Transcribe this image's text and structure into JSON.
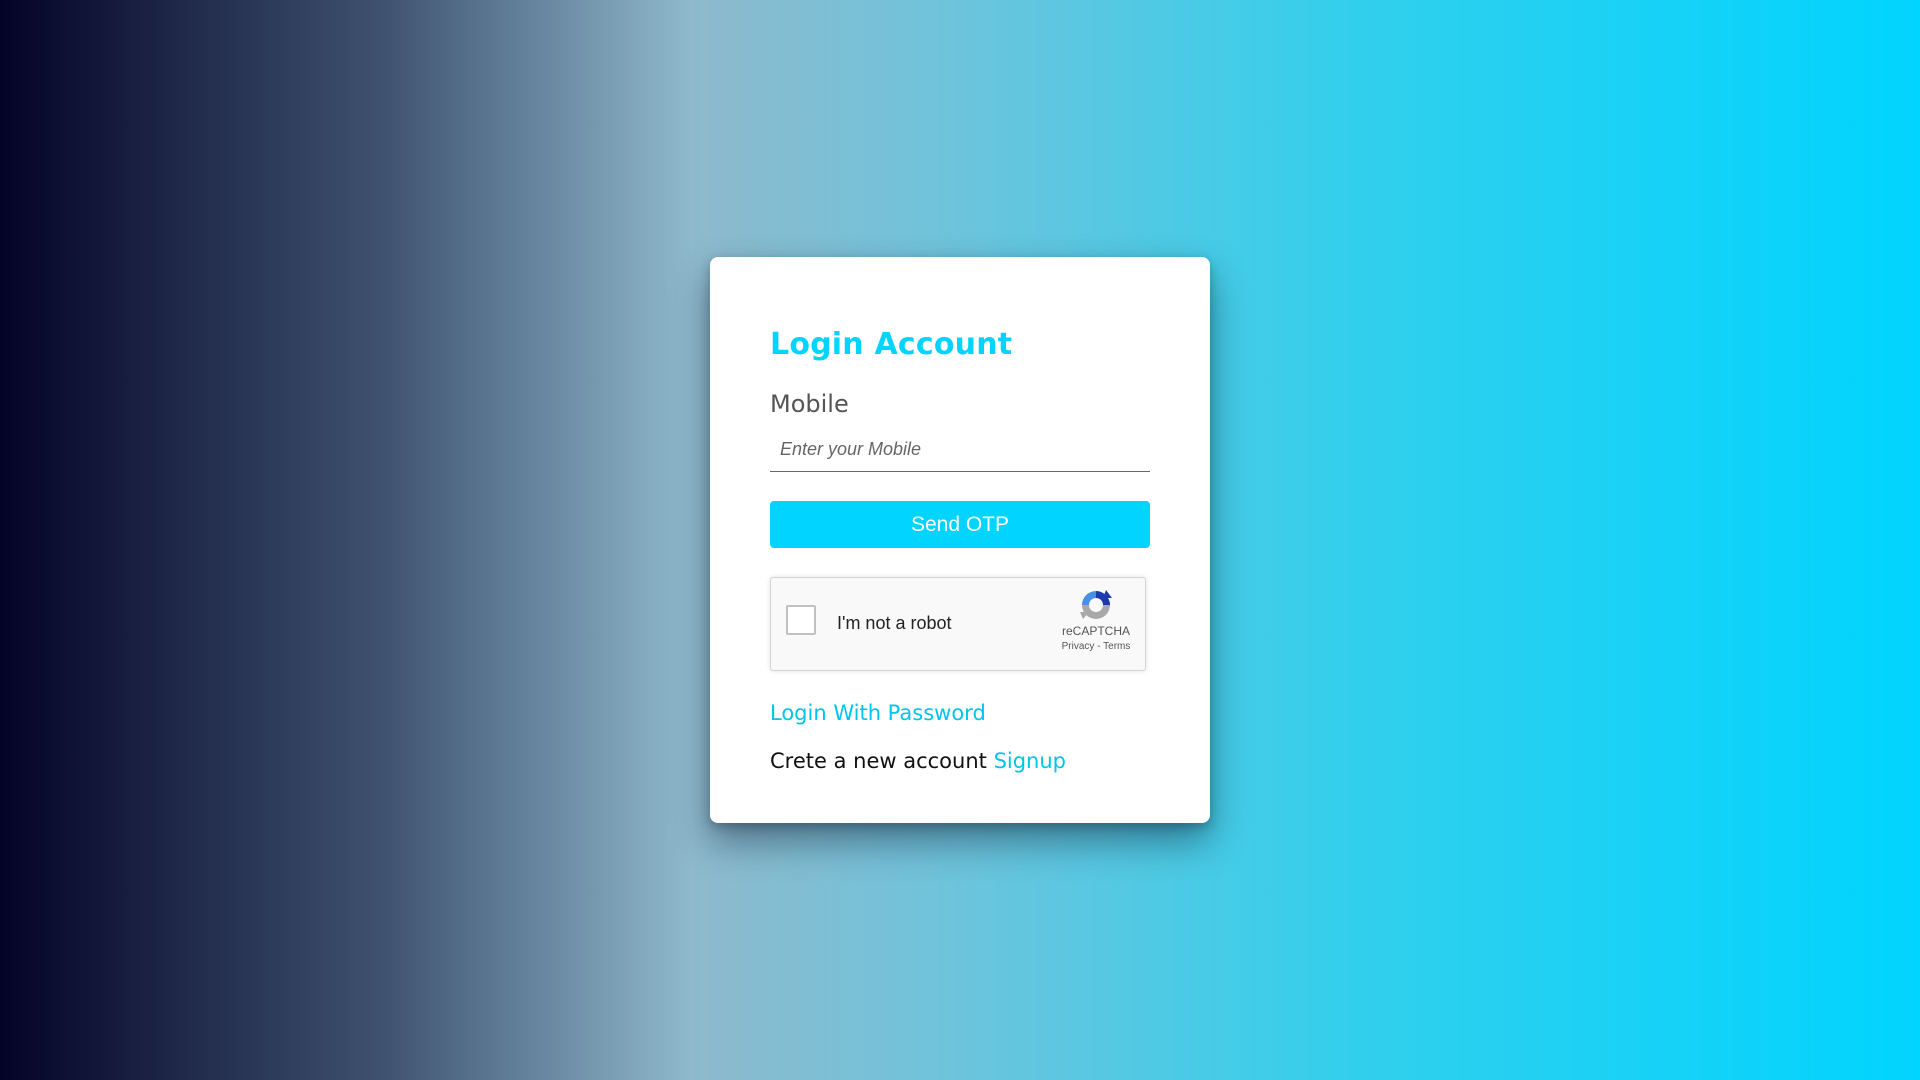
{
  "login_card": {
    "title": "Login Account",
    "mobile_label": "Mobile",
    "mobile_value": "",
    "mobile_placeholder": "Enter your Mobile",
    "send_otp_label": "Send OTP",
    "login_with_password_label": "Login With Password",
    "signup_prompt": "Crete a new account",
    "signup_link_label": "Signup"
  },
  "recaptcha": {
    "checkbox_label": "I'm not a robot",
    "checked": false,
    "brand": "reCAPTCHA",
    "privacy_label": "Privacy",
    "separator": "-",
    "terms_label": "Terms",
    "icon": "recaptcha-logo-icon"
  },
  "colors": {
    "accent": "#00d4ff",
    "background_left": "#030327",
    "background_right": "#00d4ff",
    "card": "#ffffff",
    "label_text": "#555555"
  }
}
